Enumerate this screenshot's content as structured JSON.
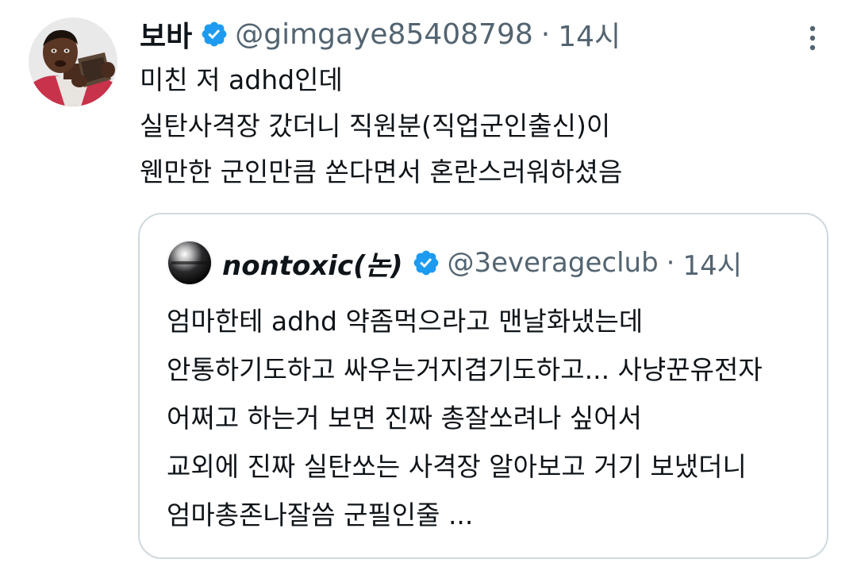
{
  "tweet": {
    "display_name": "보바",
    "handle": "@gimgaye85408798",
    "separator": "·",
    "time": "14시",
    "avatar_icon": "profile-photo",
    "verified_icon": "verified-badge-icon",
    "more_icon": "vertical-ellipsis-icon",
    "text_lines": [
      "미친 저 adhd인데",
      "실탄사격장 갔더니 직원분(직업군인출신)이",
      "웬만한 군인만큼 쏜다면서 혼란스러워하셨음"
    ]
  },
  "quoted_tweet": {
    "display_name": "nontoxic(논)",
    "handle": "@3everageclub",
    "separator": "·",
    "time": "14시",
    "avatar_icon": "chrome-sphere-avatar",
    "verified_icon": "verified-badge-icon",
    "text_lines": [
      "엄마한테 adhd 약좀먹으라고 맨날화냈는데",
      "안통하기도하고 싸우는거지겹기도하고... 사냥꾼유전자",
      "어쩌고 하는거 보면 진짜 총잘쏘려나 싶어서",
      "교외에 진짜 실탄쏘는 사격장 알아보고 거기 보냈더니",
      "엄마총존나잘씀 군필인줄 ..."
    ]
  },
  "colors": {
    "text_primary": "#0f1419",
    "text_secondary": "#536471",
    "verified_blue": "#1d9bf0",
    "border": "#cfd9de"
  }
}
